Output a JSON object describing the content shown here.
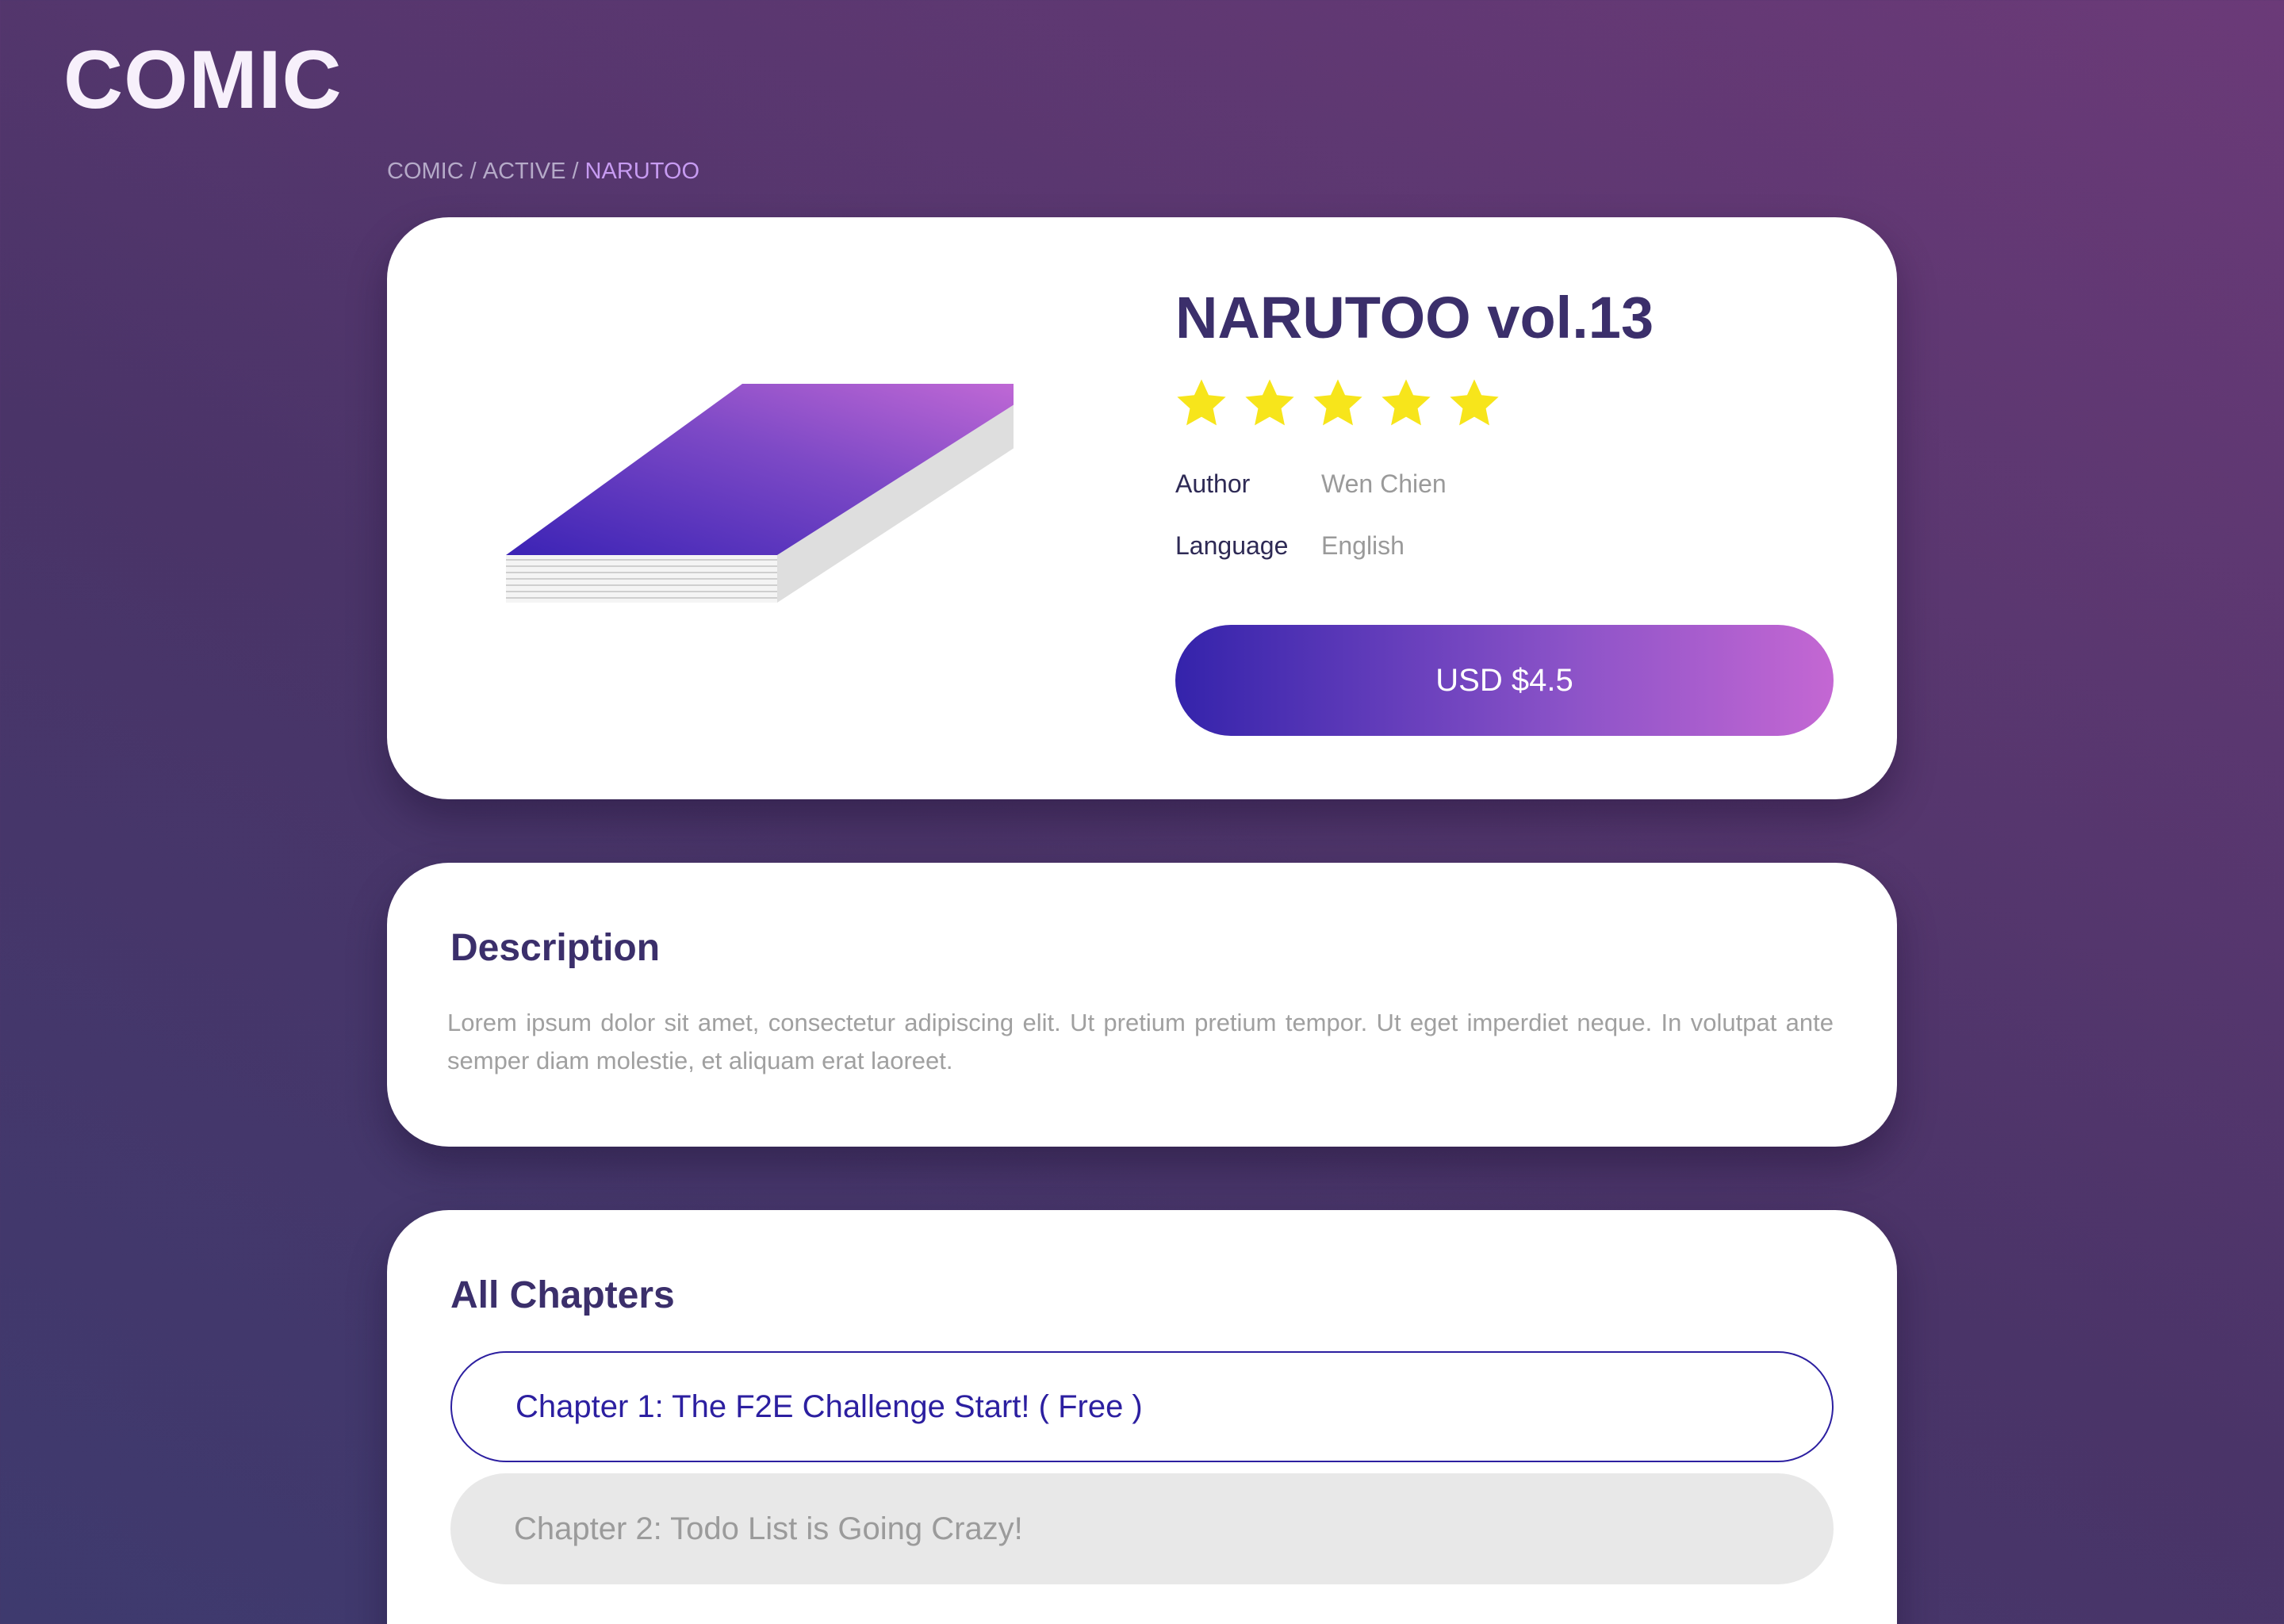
{
  "app": {
    "logo": "COMIC"
  },
  "breadcrumb": {
    "items": [
      "COMIC",
      "ACTIVE"
    ],
    "current": "NARUTOO",
    "separator": "/"
  },
  "product": {
    "title": "NARUTOO vol.13",
    "rating": {
      "value": 5,
      "max": 5
    },
    "author_label": "Author",
    "author_value": "Wen Chien",
    "language_label": "Language",
    "language_value": "English",
    "price_button": "USD $4.5"
  },
  "description": {
    "title": "Description",
    "text": "Lorem ipsum dolor sit amet, consectetur adipiscing elit. Ut pretium pretium tempor. Ut eget imperdiet neque. In volutpat ante semper diam molestie, et aliquam erat laoreet."
  },
  "chapters": {
    "title": "All Chapters",
    "items": [
      {
        "label": "Chapter 1: The F2E Challenge Start! ( Free )"
      },
      {
        "label": "Chapter 2: Todo List is Going Crazy!"
      }
    ]
  },
  "colors": {
    "accent": "#2c1fa0",
    "gradient_start": "#3423ab",
    "gradient_end": "#c467d3",
    "star": "#f7e51b",
    "heading": "#3b2f6b"
  }
}
